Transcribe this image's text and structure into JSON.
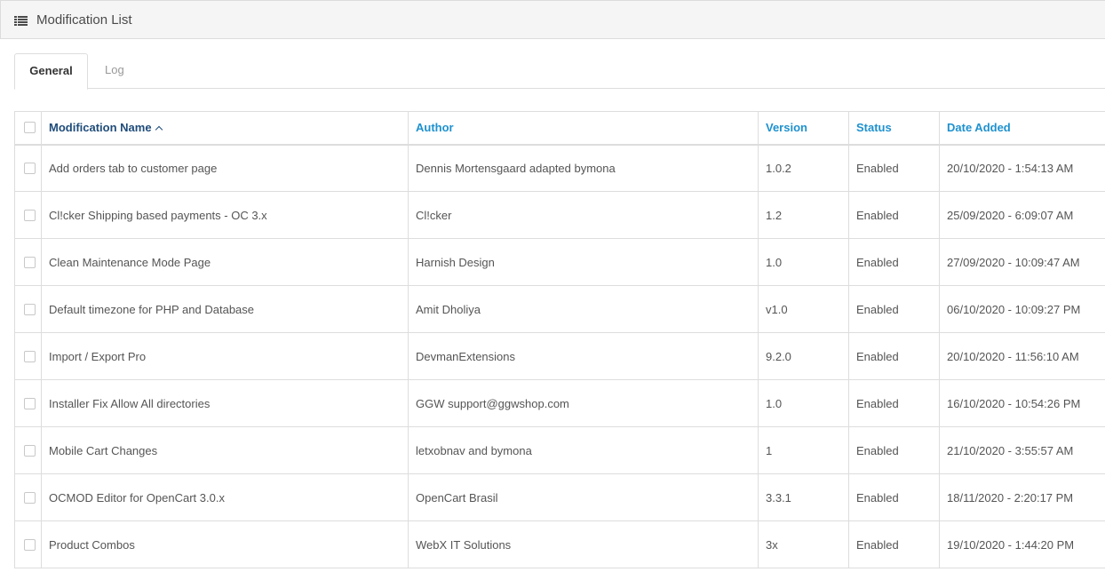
{
  "header": {
    "title": "Modification List",
    "icon": "list-icon"
  },
  "tabs": [
    {
      "label": "General",
      "active": true
    },
    {
      "label": "Log",
      "active": false
    }
  ],
  "table": {
    "columns": [
      "Modification Name",
      "Author",
      "Version",
      "Status",
      "Date Added"
    ],
    "sorted_column": "Modification Name",
    "sort_direction": "ascending",
    "rows": [
      {
        "name": "Add orders tab to customer page",
        "author": "Dennis Mortensgaard adapted bymona",
        "version": "1.0.2",
        "status": "Enabled",
        "date_added": "20/10/2020 - 1:54:13 AM"
      },
      {
        "name": "Cl!cker Shipping based payments - OC 3.x",
        "author": "Cl!cker",
        "version": "1.2",
        "status": "Enabled",
        "date_added": "25/09/2020 - 6:09:07 AM"
      },
      {
        "name": "Clean Maintenance Mode Page",
        "author": "Harnish Design",
        "version": "1.0",
        "status": "Enabled",
        "date_added": "27/09/2020 - 10:09:47 AM"
      },
      {
        "name": "Default timezone for PHP and Database",
        "author": "Amit Dholiya",
        "version": "v1.0",
        "status": "Enabled",
        "date_added": "06/10/2020 - 10:09:27 PM"
      },
      {
        "name": "Import / Export Pro",
        "author": "DevmanExtensions",
        "version": "9.2.0",
        "status": "Enabled",
        "date_added": "20/10/2020 - 11:56:10 AM"
      },
      {
        "name": "Installer Fix Allow All directories",
        "author": "GGW support@ggwshop.com",
        "version": "1.0",
        "status": "Enabled",
        "date_added": "16/10/2020 - 10:54:26 PM"
      },
      {
        "name": "Mobile Cart Changes",
        "author": "letxobnav and bymona",
        "version": "1",
        "status": "Enabled",
        "date_added": "21/10/2020 - 3:55:57 AM"
      },
      {
        "name": "OCMOD Editor for OpenCart 3.0.x",
        "author": "OpenCart Brasil",
        "version": "3.3.1",
        "status": "Enabled",
        "date_added": "18/11/2020 - 2:20:17 PM"
      },
      {
        "name": "Product Combos",
        "author": "WebX IT Solutions",
        "version": "3x",
        "status": "Enabled",
        "date_added": "19/10/2020 - 1:44:20 PM"
      }
    ]
  },
  "colors": {
    "link": "#1e91cf",
    "sorted_link": "#1f4c7a",
    "header_bg": "#f5f5f5",
    "border": "#dddddd"
  }
}
